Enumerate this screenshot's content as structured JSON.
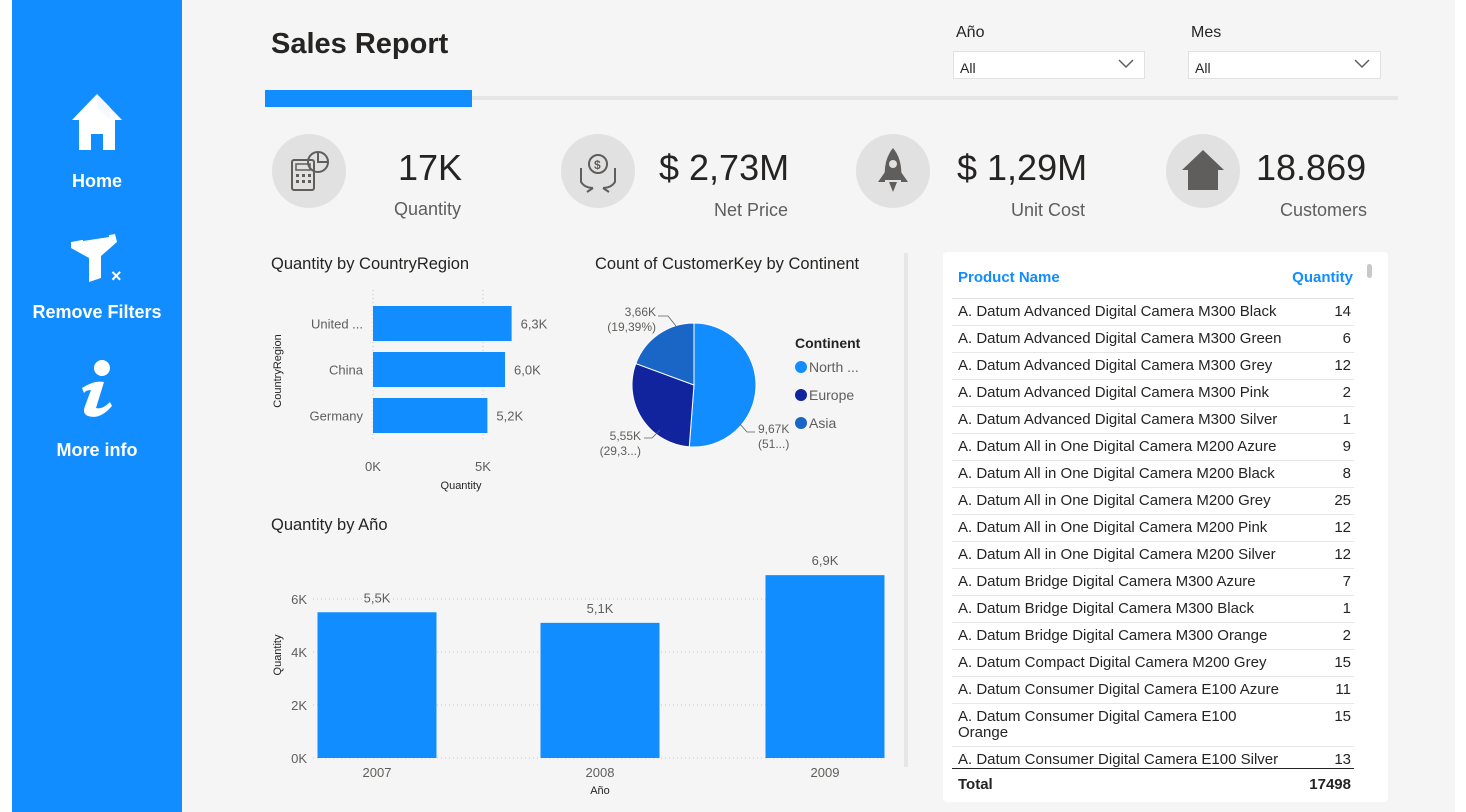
{
  "sidebar": {
    "home_label": "Home",
    "remove_filters_label": "Remove Filters",
    "more_info_label": "More info"
  },
  "header": {
    "title": "Sales Report"
  },
  "slicers": {
    "year": {
      "label": "Año",
      "value": "All"
    },
    "month": {
      "label": "Mes",
      "value": "All"
    }
  },
  "kpis": {
    "quantity": {
      "value": "17K",
      "label": "Quantity"
    },
    "net_price": {
      "value": "$ 2,73M",
      "label": "Net Price"
    },
    "unit_cost": {
      "value": "$ 1,29M",
      "label": "Unit Cost"
    },
    "customers": {
      "value": "18.869",
      "label": "Customers"
    }
  },
  "colors": {
    "accent": "#118dff",
    "north_america": "#118dff",
    "europe": "#12239e",
    "asia": "#1a66c6"
  },
  "chart_data": [
    {
      "id": "country",
      "type": "bar",
      "orientation": "horizontal",
      "title": "Quantity by CountryRegion",
      "xlabel": "Quantity",
      "ylabel": "CountryRegion",
      "categories": [
        "United ...",
        "China",
        "Germany"
      ],
      "values": [
        6300,
        6000,
        5200
      ],
      "data_labels": [
        "6,3K",
        "6,0K",
        "5,2K"
      ],
      "xticks": [
        "0K",
        "5K"
      ],
      "xlim": [
        0,
        7000
      ]
    },
    {
      "id": "continent",
      "type": "pie",
      "title": "Count of CustomerKey by Continent",
      "legend_title": "Continent",
      "legend_position": "right",
      "categories": [
        "North ...",
        "Europe",
        "Asia"
      ],
      "values": [
        9670,
        5550,
        3660
      ],
      "data_labels": [
        "9,67K\n(51...)",
        "5,55K\n(29,3...)",
        "3,66K\n(19,39%)"
      ]
    },
    {
      "id": "year",
      "type": "bar",
      "title": "Quantity by Año",
      "xlabel": "Año",
      "ylabel": "Quantity",
      "categories": [
        "2007",
        "2008",
        "2009"
      ],
      "values": [
        5500,
        5100,
        6900
      ],
      "data_labels": [
        "5,5K",
        "5,1K",
        "6,9K"
      ],
      "yticks": [
        "0K",
        "2K",
        "4K",
        "6K"
      ],
      "ylim": [
        0,
        7000
      ],
      "grid": true
    }
  ],
  "table": {
    "col_name": "Product Name",
    "col_qty": "Quantity",
    "rows": [
      {
        "name": "A. Datum Advanced Digital Camera M300 Black",
        "qty": "14"
      },
      {
        "name": "A. Datum Advanced Digital Camera M300 Green",
        "qty": "6"
      },
      {
        "name": "A. Datum Advanced Digital Camera M300 Grey",
        "qty": "12"
      },
      {
        "name": "A. Datum Advanced Digital Camera M300 Pink",
        "qty": "2"
      },
      {
        "name": "A. Datum Advanced Digital Camera M300 Silver",
        "qty": "1"
      },
      {
        "name": "A. Datum All in One Digital Camera M200 Azure",
        "qty": "9"
      },
      {
        "name": "A. Datum All in One Digital Camera M200 Black",
        "qty": "8"
      },
      {
        "name": "A. Datum All in One Digital Camera M200 Grey",
        "qty": "25"
      },
      {
        "name": "A. Datum All in One Digital Camera M200 Pink",
        "qty": "12"
      },
      {
        "name": "A. Datum All in One Digital Camera M200 Silver",
        "qty": "12"
      },
      {
        "name": "A. Datum Bridge Digital Camera M300 Azure",
        "qty": "7"
      },
      {
        "name": "A. Datum Bridge Digital Camera M300 Black",
        "qty": "1"
      },
      {
        "name": "A. Datum Bridge Digital Camera M300 Orange",
        "qty": "2"
      },
      {
        "name": "A. Datum Compact Digital Camera M200 Grey",
        "qty": "15"
      },
      {
        "name": "A. Datum Consumer Digital Camera E100 Azure",
        "qty": "11"
      },
      {
        "name": "A. Datum Consumer Digital Camera E100 Orange",
        "qty": "15"
      },
      {
        "name": "A. Datum Consumer Digital Camera E100 Silver",
        "qty": "13"
      }
    ],
    "total_label": "Total",
    "total_value": "17498"
  }
}
